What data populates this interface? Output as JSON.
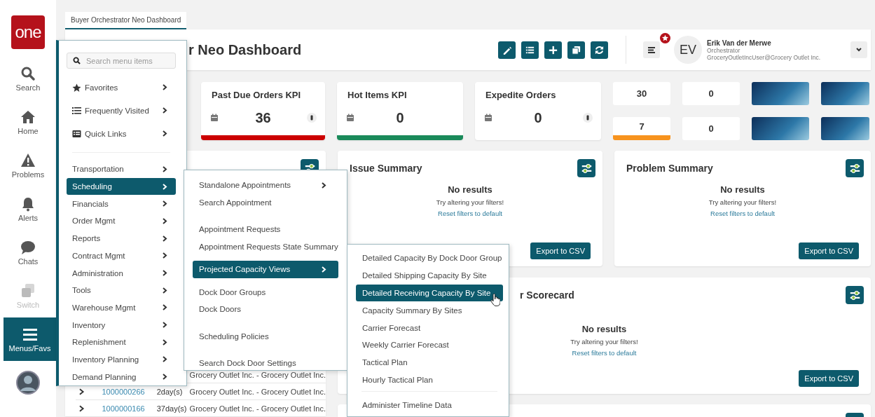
{
  "logo": {
    "text": "one"
  },
  "nav_rail": [
    {
      "label": "Search",
      "selected": false,
      "disabled": false
    },
    {
      "label": "Home",
      "selected": false,
      "disabled": false
    },
    {
      "label": "Problems",
      "selected": false,
      "disabled": false
    },
    {
      "label": "Alerts",
      "selected": false,
      "disabled": false
    },
    {
      "label": "Chats",
      "selected": false,
      "disabled": false
    },
    {
      "label": "Switch",
      "selected": false,
      "disabled": true
    },
    {
      "label": "Menus/Favs",
      "selected": true,
      "disabled": false
    }
  ],
  "tabs": [
    {
      "label": "Buyer Orchestrator Neo Dashboard",
      "selected": true
    }
  ],
  "header": {
    "title": "r Neo Dashboard",
    "user": {
      "initials": "EV",
      "name": "Erik Van der Merwe",
      "role": "Orchestrator",
      "account": "GroceryOutletIncUser@Grocery Outlet Inc."
    }
  },
  "kpi_cards": [
    {
      "title": "Past Due Orders KPI",
      "value": "36",
      "color": "#cc0000",
      "menu_icon": true
    },
    {
      "title": "Hot Items KPI",
      "value": "0",
      "color": "#1a8a5a",
      "menu_icon": false
    },
    {
      "title": "Expedite Orders",
      "value": "0",
      "menu_icon": true
    }
  ],
  "stat_tiles": [
    {
      "value": "30"
    },
    {
      "value": "0"
    },
    {
      "value": "7",
      "color": "#f7931e"
    },
    {
      "value": "0"
    }
  ],
  "widgets": [
    {
      "title": "Issue Summary",
      "message": "No results",
      "hint": "Try altering your filters!",
      "link": "Reset filters to default",
      "button": "Export to CSV"
    },
    {
      "title": "Problem Summary",
      "message": "No results",
      "hint": "Try altering your filters!",
      "link": "Reset filters to default",
      "button": "Export to CSV"
    }
  ],
  "scorecard": {
    "title": "r Scorecard",
    "message": "No results",
    "hint": "Try altering your filters!",
    "link": "Reset filters to default",
    "button": "Export to CSV"
  },
  "table_rows": [
    {
      "customer": "Grocery Outlet Inc. - Grocery Outlet Inc."
    },
    {
      "id": "1000000266",
      "age": "2day(s)",
      "customer": "Grocery Outlet Inc. - Grocery Outlet Inc."
    },
    {
      "id": "1000000166",
      "age": "37day(s)",
      "customer": "Grocery Outlet Inc. - Grocery Outlet Inc."
    }
  ],
  "main_menu": {
    "search": {
      "placeholder": "Search menu items"
    },
    "groups": [
      [
        {
          "label": "Favorites",
          "selected": false,
          "has_submenu": true
        },
        {
          "label": "Frequently Visited",
          "selected": false,
          "has_submenu": true
        },
        {
          "label": "Quick Links",
          "selected": false,
          "has_submenu": true
        }
      ],
      [
        {
          "label": "Transportation",
          "selected": false,
          "has_submenu": true
        },
        {
          "label": "Scheduling",
          "selected": true,
          "has_submenu": true
        },
        {
          "label": "Financials",
          "selected": false,
          "has_submenu": true
        },
        {
          "label": "Order Mgmt",
          "selected": false,
          "has_submenu": true
        },
        {
          "label": "Reports",
          "selected": false,
          "has_submenu": true
        },
        {
          "label": "Contract Mgmt",
          "selected": false,
          "has_submenu": true
        },
        {
          "label": "Administration",
          "selected": false,
          "has_submenu": true
        },
        {
          "label": "Tools",
          "selected": false,
          "has_submenu": true
        },
        {
          "label": "Warehouse Mgmt",
          "selected": false,
          "has_submenu": true
        },
        {
          "label": "Inventory",
          "selected": false,
          "has_submenu": true
        },
        {
          "label": "Replenishment",
          "selected": false,
          "has_submenu": true
        },
        {
          "label": "Inventory Planning",
          "selected": false,
          "has_submenu": true
        },
        {
          "label": "Demand Planning",
          "selected": false,
          "has_submenu": true
        }
      ]
    ]
  },
  "submenu": {
    "groups": [
      [
        {
          "label": "Standalone Appointments",
          "selected": false,
          "has_submenu": true
        },
        {
          "label": "Search Appointment",
          "selected": false,
          "has_submenu": false
        }
      ],
      [
        {
          "label": "Appointment Requests",
          "selected": false,
          "has_submenu": false
        },
        {
          "label": "Appointment Requests State Summary",
          "selected": false,
          "has_submenu": false
        },
        {
          "label": "Projected Capacity Views",
          "selected": true,
          "has_submenu": true
        },
        {
          "label": "Dock Door Groups",
          "selected": false,
          "has_submenu": false
        },
        {
          "label": "Dock Doors",
          "selected": false,
          "has_submenu": false
        }
      ],
      [
        {
          "label": "Scheduling Policies",
          "selected": false,
          "has_submenu": false
        }
      ],
      [
        {
          "label": "Search Dock Door Settings",
          "selected": false,
          "has_submenu": false
        }
      ]
    ]
  },
  "capacity_menu": {
    "groups": [
      [
        {
          "label": "Detailed Capacity By Dock Door Group",
          "selected": false,
          "has_submenu": false
        },
        {
          "label": "Detailed Shipping Capacity By Site",
          "selected": false,
          "has_submenu": false
        },
        {
          "label": "Detailed Receiving Capacity By Site",
          "selected": true,
          "has_submenu": false
        },
        {
          "label": "Capacity Summary By Sites",
          "selected": false,
          "has_submenu": false
        },
        {
          "label": "Carrier Forecast",
          "selected": false,
          "has_submenu": false
        },
        {
          "label": "Weekly Carrier Forecast",
          "selected": false,
          "has_submenu": false
        },
        {
          "label": "Tactical Plan",
          "selected": false,
          "has_submenu": false
        },
        {
          "label": "Hourly Tactical Plan",
          "selected": false,
          "has_submenu": false
        }
      ],
      [
        {
          "label": "Administer Timeline Data",
          "selected": false,
          "has_submenu": false
        }
      ]
    ]
  }
}
